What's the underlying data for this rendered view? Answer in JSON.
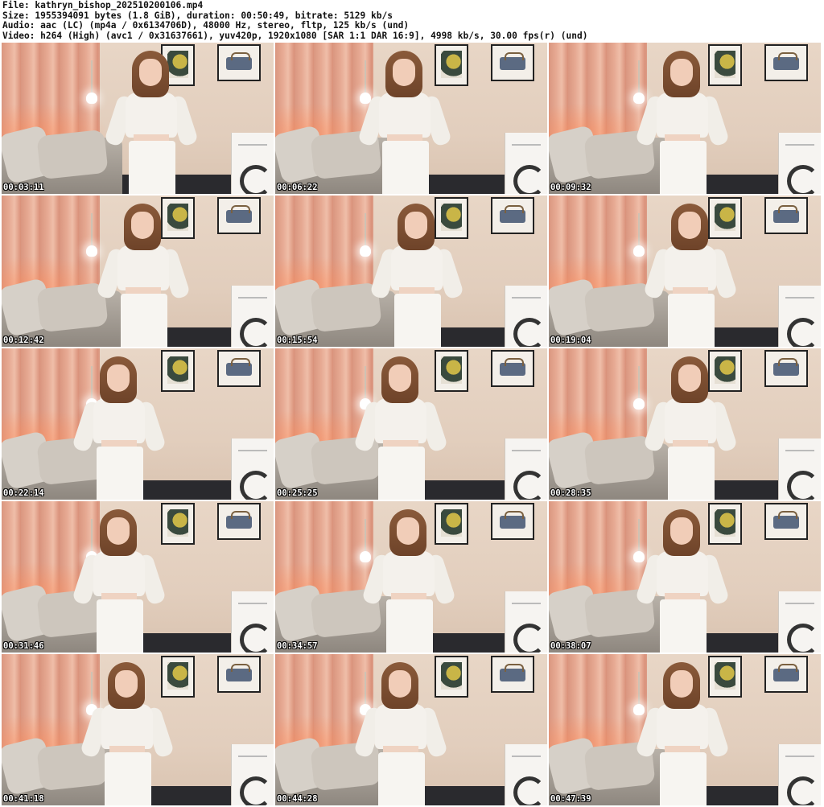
{
  "header": {
    "file": "File: kathryn_bishop_202510200106.mp4",
    "size": "Size: 1955394091 bytes (1.8 GiB), duration: 00:50:49, bitrate: 5129 kb/s",
    "audio": "Audio: aac (LC) (mp4a / 0x6134706D), 48000 Hz, stereo, fltp, 125 kb/s (und)",
    "video": "Video: h264 (High) (avc1 / 0x31637661), yuv420p, 1920x1080 [SAR 1:1 DAR 16:9], 4998 kb/s, 30.00 fps(r) (und)"
  },
  "thumbnails": [
    {
      "timestamp": "00:03:11"
    },
    {
      "timestamp": "00:06:22"
    },
    {
      "timestamp": "00:09:32"
    },
    {
      "timestamp": "00:12:42"
    },
    {
      "timestamp": "00:15:54"
    },
    {
      "timestamp": "00:19:04"
    },
    {
      "timestamp": "00:22:14"
    },
    {
      "timestamp": "00:25:25"
    },
    {
      "timestamp": "00:28:35"
    },
    {
      "timestamp": "00:31:46"
    },
    {
      "timestamp": "00:34:57"
    },
    {
      "timestamp": "00:38:07"
    },
    {
      "timestamp": "00:41:18"
    },
    {
      "timestamp": "00:44:28"
    },
    {
      "timestamp": "00:47:39"
    }
  ]
}
